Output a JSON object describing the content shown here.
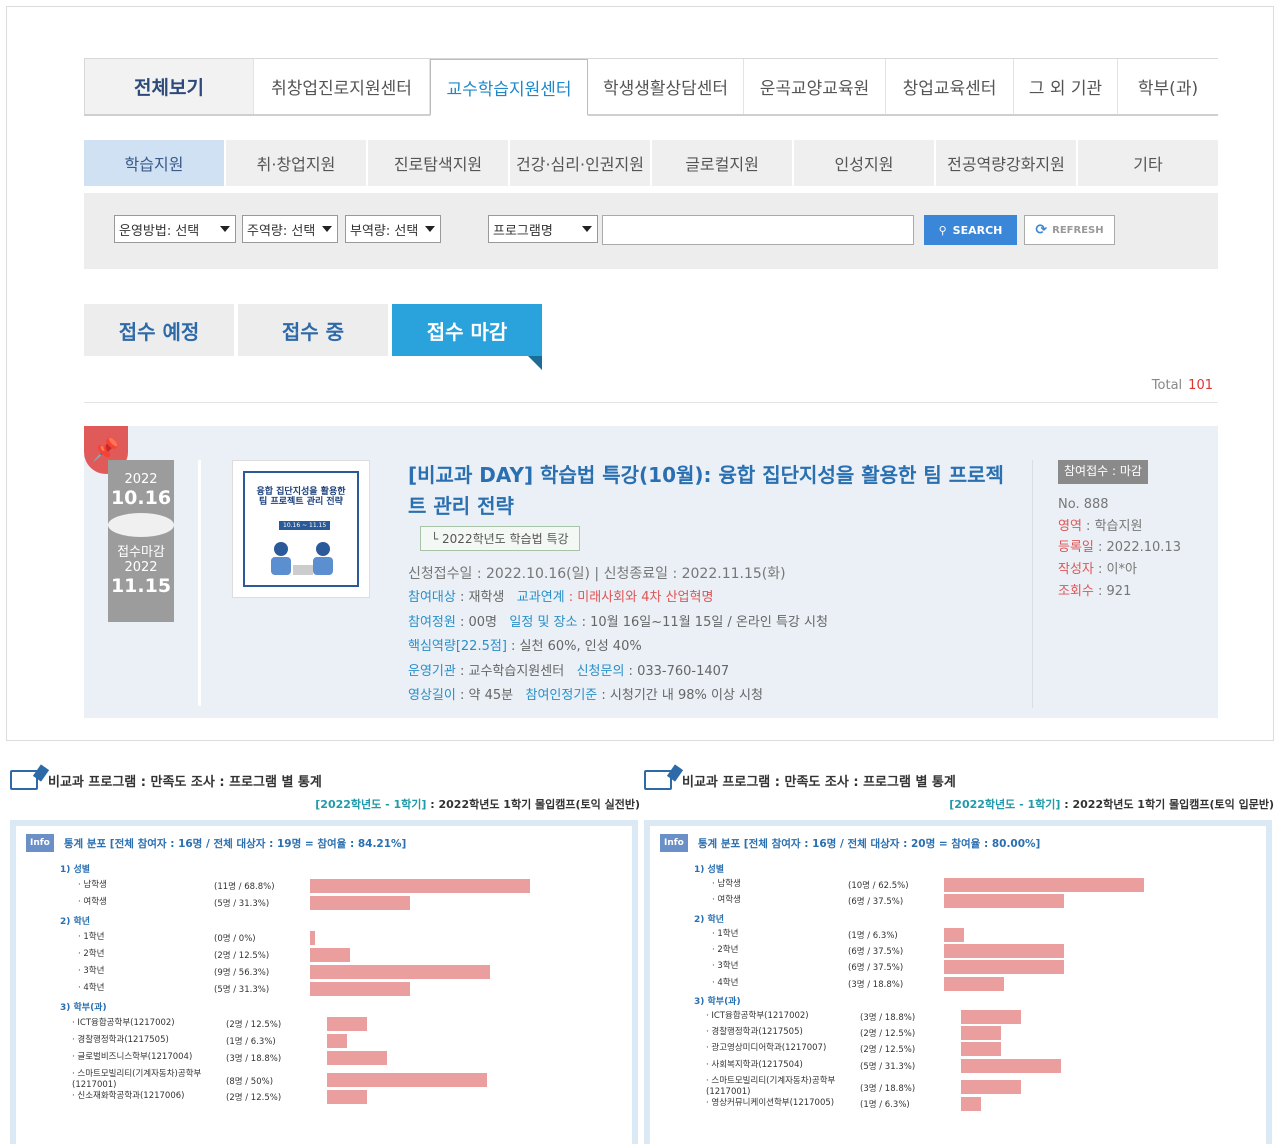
{
  "top_tabs": [
    "전체보기",
    "취창업진로지원센터",
    "교수학습지원센터",
    "학생생활상담센터",
    "운곡교양교육원",
    "창업교육센터",
    "그 외 기관",
    "학부(과)"
  ],
  "sub_tabs": [
    "학습지원",
    "취·창업지원",
    "진로탐색지원",
    "건강·심리·인권지원",
    "글로컬지원",
    "인성지원",
    "전공역량강화지원",
    "기타"
  ],
  "search": {
    "sel_method": "운영방법: 선택",
    "sel_main": "주역량: 선택",
    "sel_sub": "부역량: 선택",
    "sel_field": "프로그램명",
    "input_value": "",
    "search_label": "SEARCH",
    "refresh_label": "REFRESH"
  },
  "status_tabs": [
    "접수 예정",
    "접수 중",
    "접수 마감"
  ],
  "total": {
    "label": "Total",
    "value": "101"
  },
  "card": {
    "start_year": "2022",
    "start_date": "10.16",
    "end_label": "접수마감",
    "end_year": "2022",
    "end_date": "11.15",
    "thumb_title": "융합 집단지성을 활용한 팀 프로젝트 관리 전략",
    "thumb_date": "10.16 ~ 11.15",
    "title": "[비교과 DAY] 학습법 특강(10월): 융합 집단지성을 활용한 팀 프로젝트 관리 전략",
    "tag": "└ 2022학년도 학습법 특강",
    "apply_period": "신청접수일 : 2022.10.16(일)   |   신청종료일 : 2022.11.15(화)",
    "target_k": "참여대상",
    "target_v": " : 재학생",
    "link_k": "교과연계",
    "link_v": " : 미래사회와 4차 산업혁명",
    "quota_k": "참여정원",
    "quota_v": " : 00명",
    "place_k": "일정 및 장소",
    "place_v": " : 10월 16일~11월 15일 / 온라인 특강 시청",
    "comp_k": "핵심역량[22.5점]",
    "comp_v": " : 실천 60%, 인성 40%",
    "org_k": "운영기관",
    "org_v": " : 교수학습지원센터",
    "contact_k": "신청문의",
    "contact_v": " : 033-760-1407",
    "len_k": "영상길이",
    "len_v": " : 약 45분",
    "crit_k": "참여인정기준",
    "crit_v": " : 시청기간 내 98% 이상 시청",
    "badge": "참여접수 : 마감",
    "no": "No. 888",
    "area_k": "영역",
    "area_v": " : 학습지원",
    "reg_k": "등록일",
    "reg_v": " : 2022.10.13",
    "author_k": "작성자",
    "author_v": " : 이*아",
    "views_k": "조회수",
    "views_v": " : 921"
  },
  "stats": [
    {
      "title": "비교과 프로그램 : 만족도 조사 : 프로그램 별 통계",
      "term": "[2022학년도 - 1학기]",
      "program": " : 2022학년도 1학기 몰입캠프(토익 실전반)",
      "info_label": "Info",
      "summary": "통계 분포 [전체 참여자 : 16명 / 전체 대상자 : 19명 = 참여율 : 84.21%]",
      "sections": [
        {
          "name": "1) 성별",
          "rows": [
            {
              "label": "· 남학생",
              "pct": "(11명 / 68.8%)",
              "value": 68.8
            },
            {
              "label": "· 여학생",
              "pct": "(5명 / 31.3%)",
              "value": 31.3
            }
          ]
        },
        {
          "name": "2) 학년",
          "rows": [
            {
              "label": "· 1학년",
              "pct": "(0명 / 0%)",
              "value": 0
            },
            {
              "label": "· 2학년",
              "pct": "(2명 / 12.5%)",
              "value": 12.5
            },
            {
              "label": "· 3학년",
              "pct": "(9명 / 56.3%)",
              "value": 56.3
            },
            {
              "label": "· 4학년",
              "pct": "(5명 / 31.3%)",
              "value": 31.3
            }
          ]
        },
        {
          "name": "3) 학부(과)",
          "rows": [
            {
              "label": "· ICT융합공학부(1217002)",
              "pct": "(2명 / 12.5%)",
              "value": 12.5
            },
            {
              "label": "· 경찰행정학과(1217505)",
              "pct": "(1명 / 6.3%)",
              "value": 6.3
            },
            {
              "label": "· 글로벌비즈니스학부(1217004)",
              "pct": "(3명 / 18.8%)",
              "value": 18.8
            },
            {
              "label": "· 스마트모빌리티(기계자동차)공학부 (1217001)",
              "pct": "(8명 / 50%)",
              "value": 50
            },
            {
              "label": "· 신소재화학공학과(1217006)",
              "pct": "(2명 / 12.5%)",
              "value": 12.5
            }
          ]
        }
      ]
    },
    {
      "title": "비교과 프로그램 : 만족도 조사 : 프로그램 별 통계",
      "term": "[2022학년도 - 1학기]",
      "program": " : 2022학년도 1학기 몰입캠프(토익 입문반)",
      "info_label": "Info",
      "summary": "통계 분포 [전체 참여자 : 16명 / 전체 대상자 : 20명 = 참여율 : 80.00%]",
      "sections": [
        {
          "name": "1) 성별",
          "rows": [
            {
              "label": "· 남학생",
              "pct": "(10명 / 62.5%)",
              "value": 62.5
            },
            {
              "label": "· 여학생",
              "pct": "(6명 / 37.5%)",
              "value": 37.5
            }
          ]
        },
        {
          "name": "2) 학년",
          "rows": [
            {
              "label": "· 1학년",
              "pct": "(1명 / 6.3%)",
              "value": 6.3
            },
            {
              "label": "· 2학년",
              "pct": "(6명 / 37.5%)",
              "value": 37.5
            },
            {
              "label": "· 3학년",
              "pct": "(6명 / 37.5%)",
              "value": 37.5
            },
            {
              "label": "· 4학년",
              "pct": "(3명 / 18.8%)",
              "value": 18.8
            }
          ]
        },
        {
          "name": "3) 학부(과)",
          "rows": [
            {
              "label": "· ICT융합공학부(1217002)",
              "pct": "(3명 / 18.8%)",
              "value": 18.8
            },
            {
              "label": "· 경찰행정학과(1217505)",
              "pct": "(2명 / 12.5%)",
              "value": 12.5
            },
            {
              "label": "· 광고영상미디어학과(1217007)",
              "pct": "(2명 / 12.5%)",
              "value": 12.5
            },
            {
              "label": "· 사회복지학과(1217504)",
              "pct": "(5명 / 31.3%)",
              "value": 31.3
            },
            {
              "label": "· 스마트모빌리티(기계자동차)공학부 (1217001)",
              "pct": "(3명 / 18.8%)",
              "value": 18.8
            },
            {
              "label": "· 영상커뮤니케이션학부(1217005)",
              "pct": "(1명 / 6.3%)",
              "value": 6.3
            }
          ]
        }
      ]
    }
  ]
}
